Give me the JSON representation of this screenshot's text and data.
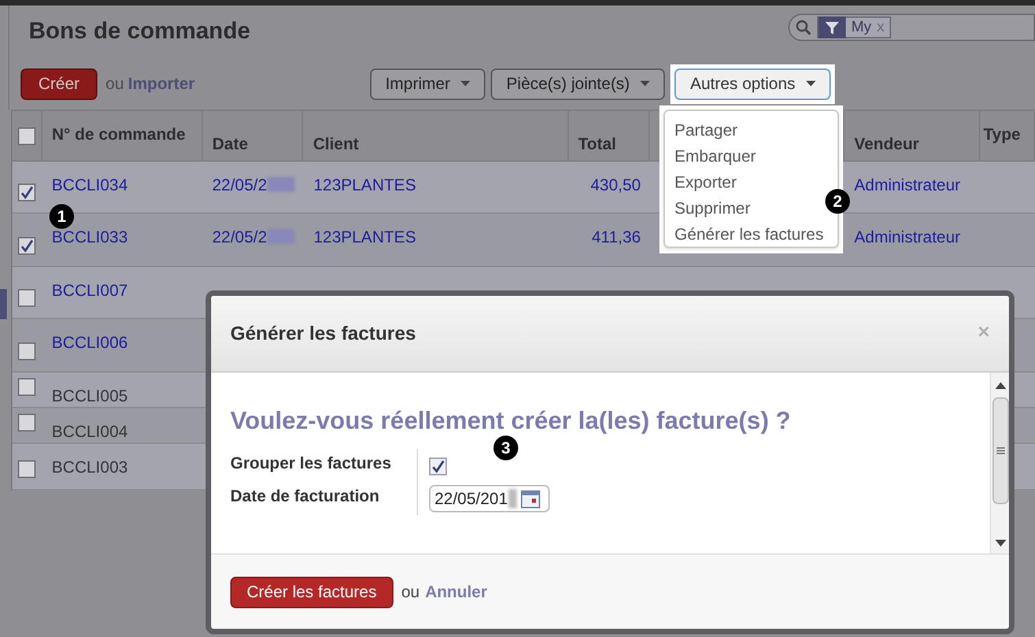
{
  "title": "Bons de commande",
  "search": {
    "facets": [
      {
        "label": "My",
        "close": "x"
      }
    ]
  },
  "toolbar": {
    "create": "Créer",
    "or": "ou",
    "import": "Importer",
    "buttons": [
      {
        "label": "Imprimer",
        "open": false
      },
      {
        "label": "Pièce(s) jointe(s)",
        "open": false
      },
      {
        "label": "Autres options",
        "open": true
      }
    ]
  },
  "menu": {
    "items": [
      "Partager",
      "Embarquer",
      "Exporter",
      "Supprimer",
      "Générer les factures"
    ]
  },
  "table": {
    "select_all": {
      "checked": false
    },
    "columns": [
      "N° de commande",
      "Date",
      "Client",
      "Total",
      "Vendeur",
      "Type"
    ],
    "rows": [
      {
        "kind": "link",
        "checked": true,
        "cells": [
          "BCCLI034",
          "22/05/2",
          "123PLANTES",
          "430,50",
          "Administrateur"
        ]
      },
      {
        "kind": "link",
        "checked": true,
        "cells": [
          "BCCLI033",
          "22/05/2",
          "123PLANTES",
          "411,36",
          "Administrateur"
        ]
      },
      {
        "kind": "link",
        "checked": false,
        "cells": [
          "BCCLI007"
        ]
      },
      {
        "kind": "link",
        "checked": false,
        "cells": [
          "BCCLI006"
        ]
      },
      {
        "kind": "plain",
        "checked": false,
        "cells": [
          "BCCLI005"
        ]
      },
      {
        "kind": "plain",
        "checked": false,
        "cells": [
          "BCCLI004"
        ]
      },
      {
        "kind": "plain",
        "checked": false,
        "cells": [
          "BCCLI003"
        ]
      }
    ]
  },
  "dialog": {
    "title": "Générer les factures",
    "close": "×",
    "question": "Voulez-vous réellement créer la(les) facture(s) ?",
    "fields": [
      {
        "kind": "checkbox",
        "label": "Grouper les factures",
        "checked": true
      },
      {
        "kind": "date",
        "label": "Date de facturation",
        "value": "22/05/201"
      }
    ],
    "confirm": "Créer les factures",
    "or": "ou",
    "cancel": "Annuler"
  },
  "markers": [
    "1",
    "2",
    "3"
  ]
}
